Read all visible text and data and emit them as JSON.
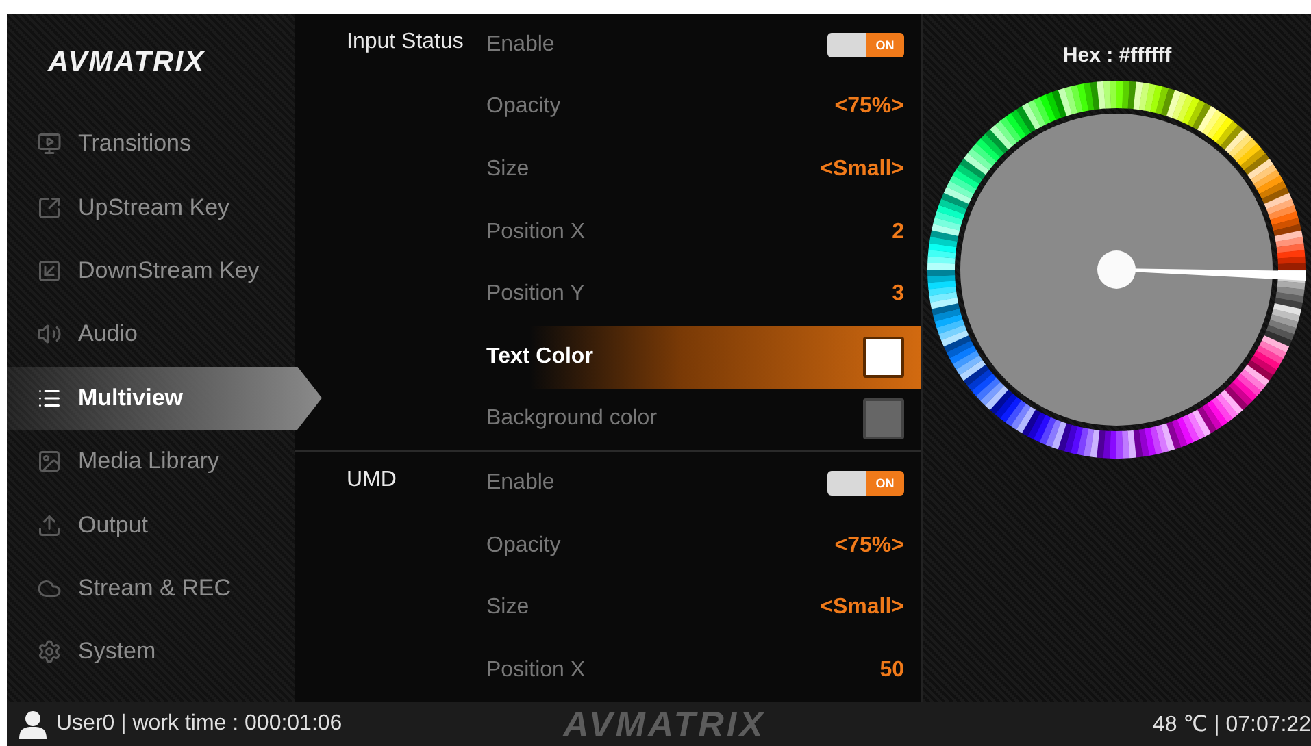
{
  "logo": {
    "text": "AVMATRIX"
  },
  "sidebar": {
    "items": [
      {
        "label": "Transitions",
        "selected": false
      },
      {
        "label": "UpStream Key",
        "selected": false
      },
      {
        "label": "DownStream Key",
        "selected": false
      },
      {
        "label": "Audio",
        "selected": false
      },
      {
        "label": "Multiview",
        "selected": true
      },
      {
        "label": "Media Library",
        "selected": false
      },
      {
        "label": "Output",
        "selected": false
      },
      {
        "label": "Stream & REC",
        "selected": false
      },
      {
        "label": "System",
        "selected": false
      }
    ]
  },
  "sections": [
    {
      "title": "Input Status",
      "rows": [
        {
          "kind": "toggle",
          "label": "Enable",
          "on": true,
          "text": "ON",
          "selected": false
        },
        {
          "kind": "value",
          "label": "Opacity",
          "value": "<75%>",
          "selected": false
        },
        {
          "kind": "value",
          "label": "Size",
          "value": "<Small>",
          "selected": false
        },
        {
          "kind": "value",
          "label": "Position X",
          "value": "2",
          "selected": false
        },
        {
          "kind": "value",
          "label": "Position Y",
          "value": "3",
          "selected": false
        },
        {
          "kind": "swatch",
          "label": "Text Color",
          "color": "#ffffff",
          "selected": true
        },
        {
          "kind": "swatch",
          "label": "Background color",
          "color": "#666666",
          "selected": false
        }
      ]
    },
    {
      "title": "UMD",
      "rows": [
        {
          "kind": "toggle",
          "label": "Enable",
          "on": true,
          "text": "ON",
          "selected": false
        },
        {
          "kind": "value",
          "label": "Opacity",
          "value": "<75%>",
          "selected": false
        },
        {
          "kind": "value",
          "label": "Size",
          "value": "<Small>",
          "selected": false
        },
        {
          "kind": "value",
          "label": "Position X",
          "value": "50",
          "selected": false
        }
      ]
    }
  ],
  "color_picker": {
    "hex": "Hex : #ffffff"
  },
  "status_bar": {
    "user": "User0 | work time : 000:01:06",
    "watermark": "AVMATRIX",
    "right": "48 ℃ | 07:07:22"
  }
}
